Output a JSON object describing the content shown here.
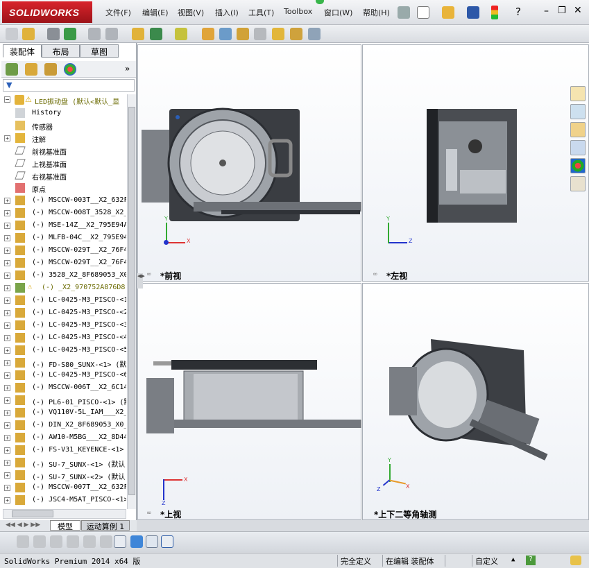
{
  "app": {
    "logo": "SOLIDWORKS",
    "title": "SolidWorks Premium 2014 x64 版"
  },
  "menu": [
    "文件(F)",
    "编辑(E)",
    "视图(V)",
    "插入(I)",
    "工具(T)",
    "Toolbox",
    "窗口(W)",
    "帮助(H)"
  ],
  "left": {
    "tabs": [
      "装配体",
      "布局",
      "草图"
    ],
    "root": "LED振动盘  (默认<默认_显",
    "tree": [
      {
        "t": "History",
        "icon": "history-icon",
        "plus": false
      },
      {
        "t": "传感器",
        "icon": "sensor-icon",
        "plus": false
      },
      {
        "t": "注解",
        "icon": "annotation-icon",
        "plus": true
      },
      {
        "t": "前视基准面",
        "icon": "plane-icon",
        "plus": false
      },
      {
        "t": "上视基准面",
        "icon": "plane-icon",
        "plus": false
      },
      {
        "t": "右视基准面",
        "icon": "plane-icon",
        "plus": false
      },
      {
        "t": "原点",
        "icon": "origin-icon",
        "plus": false
      },
      {
        "t": "(-) MSCCW-003T__X2_632F",
        "icon": "part-icon",
        "plus": true
      },
      {
        "t": "(-) MSCCW-008T_3528_X2_",
        "icon": "part-icon",
        "plus": true
      },
      {
        "t": "(-) MSE-14Z__X2_795E94A",
        "icon": "part-icon",
        "plus": true
      },
      {
        "t": "(-) MLFB-04C__X2_795E94",
        "icon": "part-icon",
        "plus": true
      },
      {
        "t": "(-) MSCCW-029T__X2_76F4",
        "icon": "part-icon",
        "plus": true
      },
      {
        "t": "(-) MSCCW-029T__X2_76F4",
        "icon": "part-icon",
        "plus": true
      },
      {
        "t": "(-) 3528_X2_8F689053_X0",
        "icon": "part-icon",
        "plus": true
      },
      {
        "t": "(-) _X2_970752A876D8",
        "icon": "warning-icon",
        "plus": true
      },
      {
        "t": "(-) LC-0425-M3_PISCO-<1",
        "icon": "part-icon",
        "plus": true
      },
      {
        "t": "(-) LC-0425-M3_PISCO-<2",
        "icon": "part-icon",
        "plus": true
      },
      {
        "t": "(-) LC-0425-M3_PISCO-<3",
        "icon": "part-icon",
        "plus": true
      },
      {
        "t": "(-) LC-0425-M3_PISCO-<4",
        "icon": "part-icon",
        "plus": true
      },
      {
        "t": "(-) LC-0425-M3_PISCO-<5",
        "icon": "part-icon",
        "plus": true
      },
      {
        "t": "(-) FD-S80_SUNX-<1> (默",
        "icon": "part-icon",
        "plus": true
      },
      {
        "t": "(-) LC-0425-M3_PISCO-<6",
        "icon": "part-icon",
        "plus": true
      },
      {
        "t": "(-) MSCCW-006T__X2_6C14",
        "icon": "part-icon",
        "plus": true
      },
      {
        "t": "(-) PL6-01_PISCO-<1> (默",
        "icon": "part-icon",
        "plus": true
      },
      {
        "t": "(-) VQ110V-5L_IAM___X2_",
        "icon": "part-icon",
        "plus": true
      },
      {
        "t": "(-) DIN_X2_8F689053_X0_",
        "icon": "part-icon",
        "plus": true
      },
      {
        "t": "(-) AW10-M5BG___X2_8D44",
        "icon": "part-icon",
        "plus": true
      },
      {
        "t": "(-) FS-V31_KEYENCE-<1>",
        "icon": "part-icon",
        "plus": true
      },
      {
        "t": "(-) SU-7_SUNX-<1> (默认",
        "icon": "part-icon",
        "plus": true
      },
      {
        "t": "(-) SU-7_SUNX-<2> (默认",
        "icon": "part-icon",
        "plus": true
      },
      {
        "t": "(-) MSCCW-007T__X2_632F",
        "icon": "part-icon",
        "plus": true
      },
      {
        "t": "(-) JSC4-M5AT_PISCO-<1>",
        "icon": "part-icon",
        "plus": true
      }
    ],
    "bottom_tabs": [
      "模型",
      "运动算例 1"
    ]
  },
  "views": {
    "front": "*前视",
    "left": "*左视",
    "top": "*上视",
    "iso": "*上下二等角轴测"
  },
  "status": {
    "fully": "完全定义",
    "editing": "在编辑 装配体",
    "custom": "自定义"
  },
  "colors": {
    "accent": "#c4161c",
    "select": "#3168c5"
  }
}
